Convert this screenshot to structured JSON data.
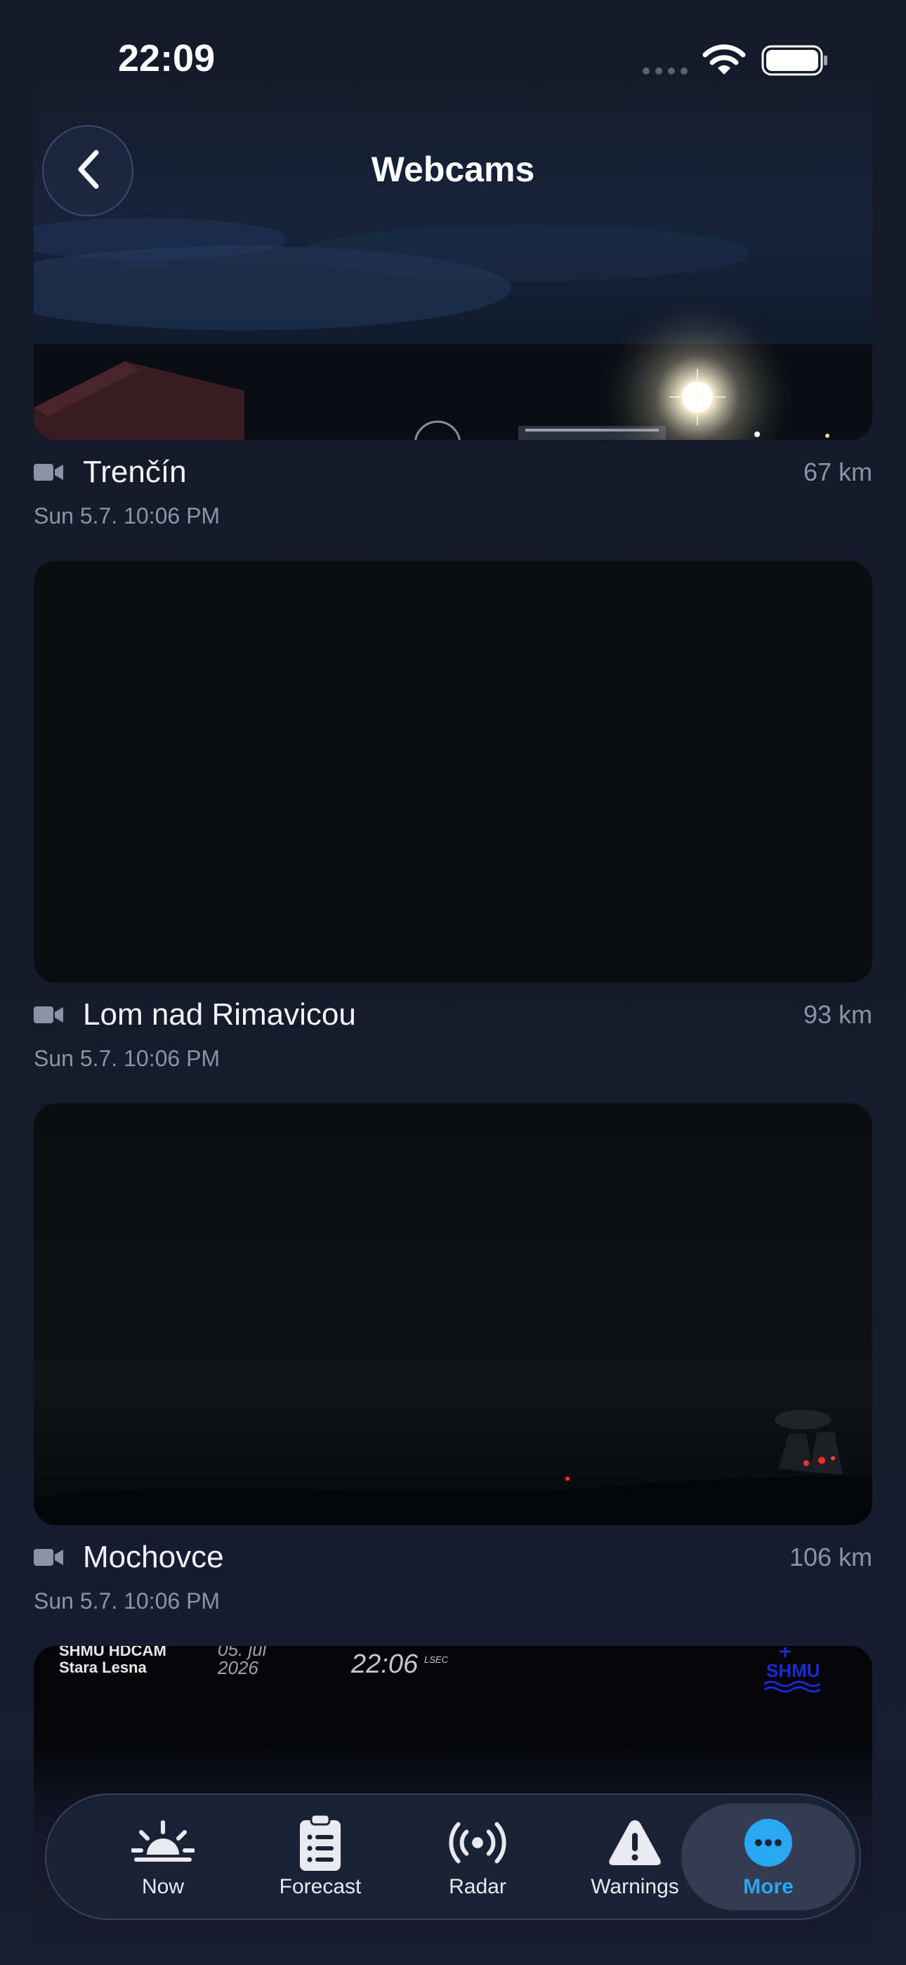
{
  "status_bar": {
    "time": "22:09"
  },
  "header": {
    "title": "Webcams"
  },
  "webcams": [
    {
      "name": "Trenčín",
      "distance": "67 km",
      "date": "Sun 5.7. 10:06 PM"
    },
    {
      "name": "Lom nad Rimavicou",
      "distance": "93 km",
      "date": "Sun 5.7. 10:06 PM"
    },
    {
      "name": "Mochovce",
      "distance": "106 km",
      "date": "Sun 5.7. 10:06 PM"
    },
    {
      "overlay_station": "SHMU HDCAM",
      "overlay_place": "Stara Lesna",
      "overlay_date_day": "05. júl",
      "overlay_date_year": "2026",
      "overlay_time": "22:06",
      "overlay_time_suffix": "LSEC",
      "overlay_logo": "SHMU"
    }
  ],
  "tab_bar": {
    "items": [
      {
        "label": "Now",
        "icon": "sunrise-icon"
      },
      {
        "label": "Forecast",
        "icon": "clipboard-list-icon"
      },
      {
        "label": "Radar",
        "icon": "radar-icon"
      },
      {
        "label": "Warnings",
        "icon": "warning-icon"
      },
      {
        "label": "More",
        "icon": "more-icon"
      }
    ],
    "active_index": 4,
    "active_color": "#29a8f2"
  }
}
